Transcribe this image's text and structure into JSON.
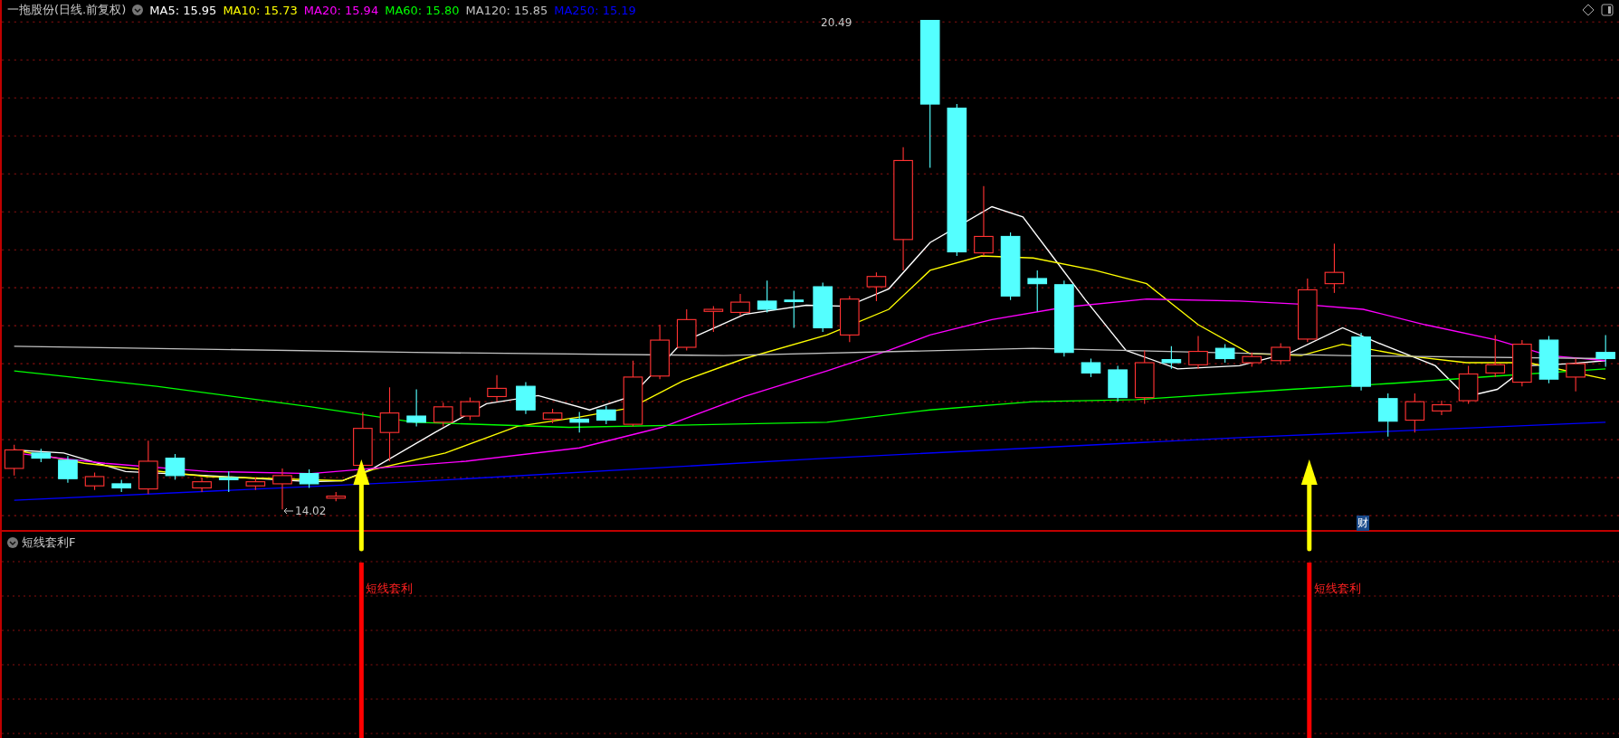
{
  "header": {
    "title": "一拖股份(日线.前复权)",
    "moving_averages": [
      {
        "label": "MA5: 15.95",
        "color": "#ffffff"
      },
      {
        "label": "MA10: 15.73",
        "color": "#ffff00"
      },
      {
        "label": "MA20: 15.94",
        "color": "#ff00ff"
      },
      {
        "label": "MA60: 15.80",
        "color": "#00ff00"
      },
      {
        "label": "MA120: 15.85",
        "color": "#c0c0c0"
      },
      {
        "label": "MA250: 15.19",
        "color": "#0000ff"
      }
    ]
  },
  "price_chart": {
    "high_label": "20.49",
    "low_label": "14.02",
    "finance_marker": "财"
  },
  "indicator": {
    "title": "短线套利F",
    "signals": [
      {
        "label": "短线套利"
      },
      {
        "label": "短线套利"
      }
    ]
  }
}
